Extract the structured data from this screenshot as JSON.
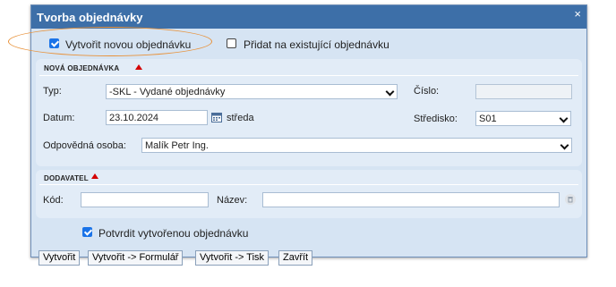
{
  "dialog": {
    "title": "Tvorba objednávky",
    "close_glyph": "×"
  },
  "mode": {
    "new_order_label": "Vytvořit novou objednávku",
    "new_order_checked": true,
    "existing_order_label": "Přidat na existující objednávku",
    "existing_order_checked": false
  },
  "new_order": {
    "section_title": "NOVÁ OBJEDNÁVKA",
    "type_label": "Typ:",
    "type_value": "-SKL - Vydané objednávky",
    "number_label": "Číslo:",
    "number_value": "",
    "date_label": "Datum:",
    "date_value": "23.10.2024",
    "weekday": "středa",
    "center_label": "Středisko:",
    "center_value": "S01",
    "person_label": "Odpovědná osoba:",
    "person_value": "Malík Petr Ing."
  },
  "supplier": {
    "section_title": "DODAVATEL",
    "code_label": "Kód:",
    "code_value": "",
    "name_label": "Název:",
    "name_value": ""
  },
  "confirm": {
    "label": "Potvrdit vytvořenou objednávku",
    "checked": true
  },
  "buttons": {
    "create": "Vytvořit",
    "create_form": "Vytvořit -> Formulář",
    "create_print": "Vytvořit -> Tisk",
    "close": "Zavřít"
  },
  "colors": {
    "titlebar": "#3d6fa8",
    "required_marker": "#d40000",
    "highlight": "#e8923a"
  }
}
